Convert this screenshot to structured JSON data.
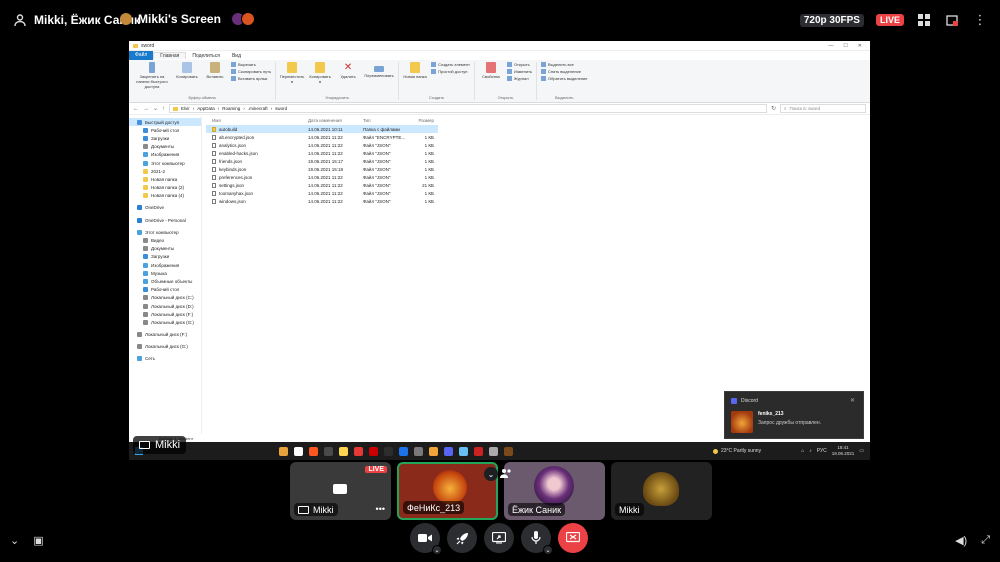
{
  "topbar": {
    "channel_title": "Mikki, Ёжик Саник",
    "screen_title": "Mikki's Screen",
    "quality": "720p 30FPS",
    "live": "LIVE"
  },
  "window": {
    "title": "sword"
  },
  "ribbon": {
    "tabs": [
      "Файл",
      "Главная",
      "Поделиться",
      "Вид"
    ],
    "clipboard": {
      "pin": "Закрепить на панели быстрого доступа",
      "copy": "Копировать",
      "paste": "Вставить",
      "cut": "Вырезать",
      "copy_path": "Скопировать путь",
      "paste_shortcut": "Вставить ярлык",
      "label": "Буфер обмена"
    },
    "organize": {
      "move": "Переместить в",
      "copy_to": "Копировать в",
      "delete": "Удалить",
      "rename": "Переименовать",
      "label": "Упорядочить"
    },
    "create": {
      "new_folder": "Новая папка",
      "new_item": "Создать элемент",
      "easy_access": "Простой доступ",
      "label": "Создать"
    },
    "open": {
      "properties": "Свойства",
      "open": "Открыть",
      "edit": "Изменить",
      "history": "Журнал",
      "label": "Открыть"
    },
    "select": {
      "select_all": "Выделить все",
      "select_none": "Снять выделение",
      "invert": "Обратить выделение",
      "label": "Выделить"
    }
  },
  "address": {
    "path": [
      "Elvir",
      "AppData",
      "Roaming",
      ".minecraft",
      "sword"
    ],
    "search_placeholder": "Поиск в: sword"
  },
  "navpane": [
    {
      "label": "Быстрый доступ",
      "color": "#4a90d9",
      "indent": false,
      "selected": true
    },
    {
      "label": "Рабочий стол",
      "color": "#3b8ed8",
      "indent": true
    },
    {
      "label": "Загрузки",
      "color": "#3b8ed8",
      "indent": true
    },
    {
      "label": "Документы",
      "color": "#8a8a8a",
      "indent": true
    },
    {
      "label": "Изображения",
      "color": "#4aa3df",
      "indent": true
    },
    {
      "label": "Этот компьютер",
      "color": "#4aa3df",
      "indent": true
    },
    {
      "label": "2021-2",
      "color": "#f2c94c",
      "indent": true
    },
    {
      "label": "Новая папка",
      "color": "#f2c94c",
      "indent": true
    },
    {
      "label": "Новая папка (2)",
      "color": "#f2c94c",
      "indent": true
    },
    {
      "label": "Новая папка (4)",
      "color": "#f2c94c",
      "indent": true
    },
    {
      "gap": true
    },
    {
      "label": "OneDrive",
      "color": "#2a7fd6",
      "indent": false
    },
    {
      "gap": true
    },
    {
      "label": "OneDrive - Personal",
      "color": "#2a7fd6",
      "indent": false
    },
    {
      "gap": true
    },
    {
      "label": "Этот компьютер",
      "color": "#4aa3df",
      "indent": false
    },
    {
      "label": "Видео",
      "color": "#8a8a8a",
      "indent": true
    },
    {
      "label": "Документы",
      "color": "#8a8a8a",
      "indent": true
    },
    {
      "label": "Загрузки",
      "color": "#3b8ed8",
      "indent": true
    },
    {
      "label": "Изображения",
      "color": "#4aa3df",
      "indent": true
    },
    {
      "label": "Музыка",
      "color": "#4aa3df",
      "indent": true
    },
    {
      "label": "Объемные объекты",
      "color": "#4aa3df",
      "indent": true
    },
    {
      "label": "Рабочий стол",
      "color": "#3b8ed8",
      "indent": true
    },
    {
      "label": "Локальный диск (C:)",
      "color": "#888888",
      "indent": true
    },
    {
      "label": "Локальный диск (D:)",
      "color": "#888888",
      "indent": true
    },
    {
      "label": "Локальный диск (F:)",
      "color": "#888888",
      "indent": true
    },
    {
      "label": "Локальный диск (G:)",
      "color": "#888888",
      "indent": true
    },
    {
      "gap": true
    },
    {
      "label": "Локальный диск (F:)",
      "color": "#888888",
      "indent": false
    },
    {
      "gap": true
    },
    {
      "label": "Локальный диск (G:)",
      "color": "#888888",
      "indent": false
    },
    {
      "gap": true
    },
    {
      "label": "Сеть",
      "color": "#4aa3df",
      "indent": false
    }
  ],
  "files": {
    "headers": [
      "Имя",
      "Дата изменения",
      "Тип",
      "Размер"
    ],
    "rows": [
      {
        "name": "autobuild",
        "date": "14.06.2021 10:11",
        "type": "Папка с файлами",
        "size": "",
        "folder": true,
        "selected": true
      },
      {
        "name": "alt.encrypted.json",
        "date": "14.06.2021 11:22",
        "type": "Файл \"ENCRYPTE...",
        "size": "1 КБ"
      },
      {
        "name": "analytics.json",
        "date": "14.06.2021 11:22",
        "type": "Файл \"JSON\"",
        "size": "1 КБ"
      },
      {
        "name": "enabled-hacks.json",
        "date": "14.06.2021 11:22",
        "type": "Файл \"JSON\"",
        "size": "1 КБ"
      },
      {
        "name": "friends.json",
        "date": "19.06.2021 15:17",
        "type": "Файл \"JSON\"",
        "size": "1 КБ"
      },
      {
        "name": "keybinds.json",
        "date": "19.06.2021 15:18",
        "type": "Файл \"JSON\"",
        "size": "1 КБ"
      },
      {
        "name": "preferences.json",
        "date": "14.06.2021 11:22",
        "type": "Файл \"JSON\"",
        "size": "1 КБ"
      },
      {
        "name": "settings.json",
        "date": "14.06.2021 11:22",
        "type": "Файл \"JSON\"",
        "size": "21 КБ"
      },
      {
        "name": "toomanyhax.json",
        "date": "14.06.2021 11:22",
        "type": "Файл \"JSON\"",
        "size": "1 КБ"
      },
      {
        "name": "windows.json",
        "date": "14.06.2021 11:22",
        "type": "Файл \"JSON\"",
        "size": "1 КБ"
      }
    ]
  },
  "statusbar": {
    "text": "Выбран 1 элемент"
  },
  "taskbar": {
    "weather": "23°C  Partly sunny",
    "lang": "РУС",
    "time": "18:41",
    "date": "19.06.2021",
    "app_colors": [
      "#e8a33a",
      "#ffffff",
      "#ff5722",
      "#4a4a4a",
      "#ffd54f",
      "#e53935",
      "#cc0000",
      "#2d2d2d",
      "#1a73e8",
      "#7a7a7a",
      "#f2a43a",
      "#5865f2",
      "#66c0f4",
      "#cc2222",
      "#aaaaaa",
      "#7a4a1a"
    ]
  },
  "notification": {
    "app": "Discord",
    "name": "feniks_213",
    "message": "Запрос дружбы отправлен."
  },
  "stream_chip": {
    "name": "Mikki"
  },
  "tiles": [
    {
      "name": "Mikki",
      "live": "LIVE"
    },
    {
      "name": "ФеНиКс_213"
    },
    {
      "name": "Ёжик Саник"
    },
    {
      "name": "Mikki"
    }
  ]
}
